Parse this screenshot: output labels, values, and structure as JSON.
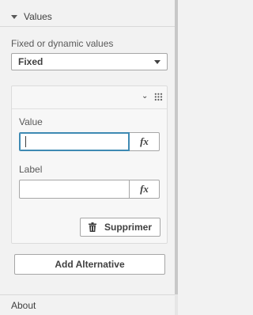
{
  "section": {
    "title": "Values",
    "toggle_icon": "caret-down-icon"
  },
  "value_mode": {
    "label": "Fixed or dynamic values",
    "selected": "Fixed",
    "options": [
      "Fixed"
    ]
  },
  "alternative_card": {
    "collapse_icon": "chevron-down-icon",
    "drag_icon": "drag-handle-icon",
    "value_field": {
      "label": "Value",
      "value": "",
      "fx_label": "fx"
    },
    "label_field": {
      "label": "Label",
      "value": "",
      "fx_label": "fx"
    },
    "delete_button": {
      "label": "Supprimer",
      "icon": "trash-icon"
    }
  },
  "add_button": {
    "label": "Add Alternative"
  },
  "next_section": {
    "title": "About"
  },
  "colors": {
    "focus": "#3f8ab3",
    "panel_bg": "#f2f2f2",
    "text": "#404040"
  }
}
